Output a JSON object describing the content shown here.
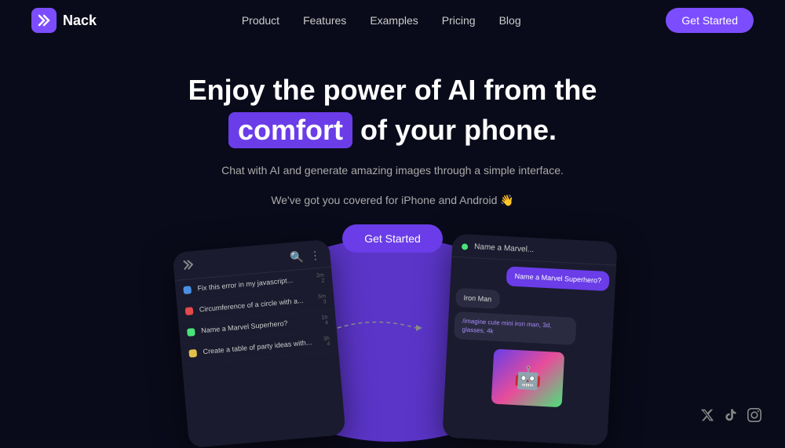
{
  "brand": {
    "logo_text": "Nack",
    "logo_icon": "✕"
  },
  "nav": {
    "links": [
      {
        "label": "Product",
        "id": "product"
      },
      {
        "label": "Features",
        "id": "features"
      },
      {
        "label": "Examples",
        "id": "examples"
      },
      {
        "label": "Pricing",
        "id": "pricing"
      },
      {
        "label": "Blog",
        "id": "blog"
      }
    ],
    "cta": "Get Started"
  },
  "hero": {
    "title_line1": "Enjoy the power of AI from the",
    "title_highlight": "comfort",
    "title_line2_rest": "of your phone.",
    "subtitle_line1": "Chat with AI and generate amazing images through a simple interface.",
    "subtitle_line2": "We've got you covered for iPhone and Android 👋",
    "cta": "Get Started"
  },
  "phone_left": {
    "header_icon1": "🔍",
    "header_icon2": "⋮",
    "logo_icon": "✕",
    "chat_items": [
      {
        "color": "blue",
        "text": "Fix this error in my javascript...",
        "time": "2m",
        "count": "2"
      },
      {
        "color": "red",
        "text": "Circumference of a circle with a...",
        "time": "5m",
        "count": "3"
      },
      {
        "color": "green",
        "text": "Name a Marvel Superhero?",
        "time": "1h",
        "count": "4"
      },
      {
        "color": "yellow",
        "text": "Create a table of party ideas with...",
        "time": "3h",
        "count": "4"
      }
    ]
  },
  "phone_right": {
    "header_text": "Name a Marvel...",
    "messages": [
      {
        "type": "user",
        "text": "Name a Marvel Superhero?"
      },
      {
        "type": "ai",
        "text": "Iron Man"
      },
      {
        "type": "command",
        "text": "/imagine cute mini iron man, 3d, glasses, 4k"
      },
      {
        "type": "image",
        "emoji": "🤖"
      }
    ]
  },
  "social": {
    "icons": [
      "twitter",
      "tiktok",
      "instagram"
    ]
  },
  "colors": {
    "accent": "#6a3de8",
    "bg": "#0a0b1a"
  }
}
